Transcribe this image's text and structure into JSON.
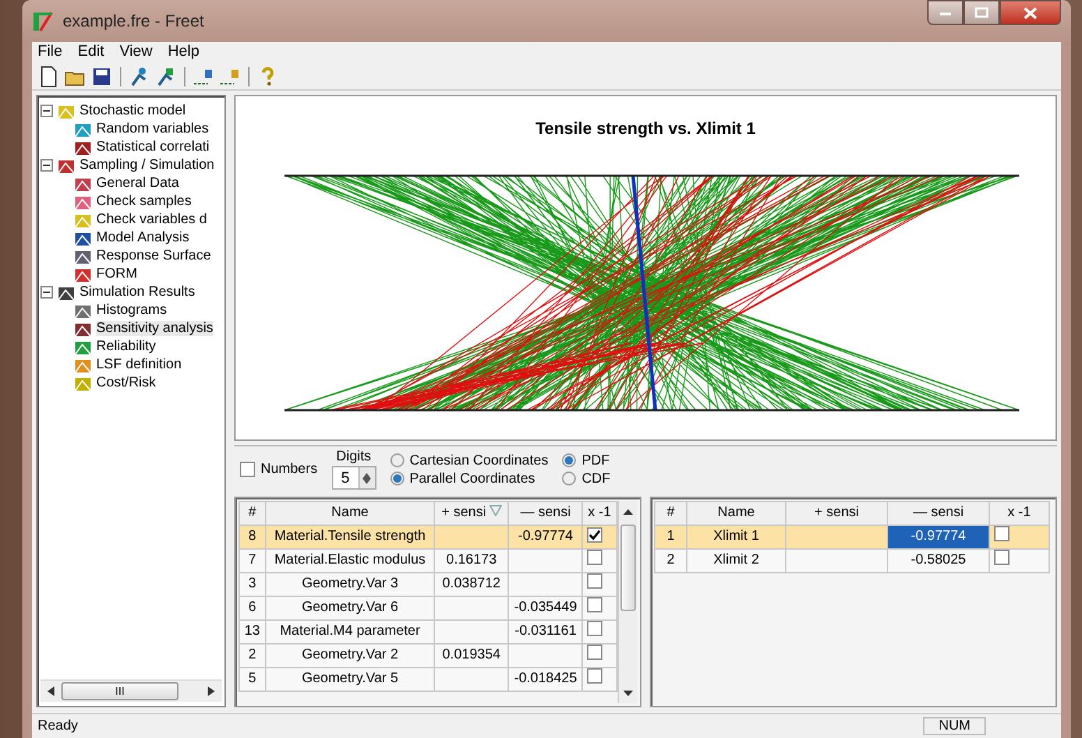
{
  "window": {
    "title": "example.fre - Freet"
  },
  "menu": [
    "File",
    "Edit",
    "View",
    "Help"
  ],
  "tree": [
    {
      "label": "Stochastic model",
      "expanded": true,
      "children": [
        {
          "label": "Random variables",
          "selected": false
        },
        {
          "label": "Statistical correlati",
          "selected": false
        }
      ]
    },
    {
      "label": "Sampling / Simulation",
      "expanded": true,
      "children": [
        {
          "label": "General Data",
          "selected": false
        },
        {
          "label": "Check samples",
          "selected": false
        },
        {
          "label": "Check variables d",
          "selected": false
        },
        {
          "label": "Model Analysis",
          "selected": false
        },
        {
          "label": "Response Surface",
          "selected": false
        },
        {
          "label": "FORM",
          "selected": false
        }
      ]
    },
    {
      "label": "Simulation Results",
      "expanded": true,
      "children": [
        {
          "label": "Histograms",
          "selected": false
        },
        {
          "label": "Sensitivity analysis",
          "selected": true
        },
        {
          "label": "Reliability",
          "selected": false
        },
        {
          "label": "LSF definition",
          "selected": false
        },
        {
          "label": "Cost/Risk",
          "selected": false
        }
      ]
    }
  ],
  "tree_scrollbar": {
    "grip": "III"
  },
  "chart": {
    "title": "Tensile strength vs. Xlimit 1"
  },
  "options": {
    "numbers": {
      "label": "Numbers",
      "checked": false
    },
    "digits": {
      "label": "Digits",
      "value": "5"
    },
    "coordinates": [
      {
        "label": "Cartesian Coordinates",
        "selected": false
      },
      {
        "label": "Parallel Coordinates",
        "selected": true
      }
    ],
    "distribution": [
      {
        "label": "PDF",
        "selected": true
      },
      {
        "label": "CDF",
        "selected": false
      }
    ]
  },
  "left_table": {
    "columns": [
      {
        "label": "#",
        "sorted": false
      },
      {
        "label": "Name",
        "sorted": false
      },
      {
        "label": "+ sensi",
        "sorted": true
      },
      {
        "label": "— sensi",
        "sorted": false
      },
      {
        "label": "x -1",
        "sorted": false
      }
    ],
    "rows": [
      {
        "index": "8",
        "name": "Material.Tensile strength",
        "plus": "",
        "minus": "-0.97774",
        "checked": true,
        "selected": true,
        "minus_selected": false
      },
      {
        "index": "7",
        "name": "Material.Elastic modulus",
        "plus": "0.16173",
        "minus": "",
        "checked": false,
        "selected": false,
        "minus_selected": false
      },
      {
        "index": "3",
        "name": "Geometry.Var 3",
        "plus": "0.038712",
        "minus": "",
        "checked": false,
        "selected": false,
        "minus_selected": false
      },
      {
        "index": "6",
        "name": "Geometry.Var 6",
        "plus": "",
        "minus": "-0.035449",
        "checked": false,
        "selected": false,
        "minus_selected": false
      },
      {
        "index": "13",
        "name": "Material.M4 parameter",
        "plus": "",
        "minus": "-0.031161",
        "checked": false,
        "selected": false,
        "minus_selected": false
      },
      {
        "index": "2",
        "name": "Geometry.Var 2",
        "plus": "0.019354",
        "minus": "",
        "checked": false,
        "selected": false,
        "minus_selected": false
      },
      {
        "index": "5",
        "name": "Geometry.Var 5",
        "plus": "",
        "minus": "-0.018425",
        "checked": false,
        "selected": false,
        "minus_selected": false
      }
    ]
  },
  "right_table": {
    "columns": [
      {
        "label": "#",
        "sorted": false
      },
      {
        "label": "Name",
        "sorted": false
      },
      {
        "label": "+ sensi",
        "sorted": false
      },
      {
        "label": "— sensi",
        "sorted": false
      },
      {
        "label": "x -1",
        "sorted": false
      }
    ],
    "rows": [
      {
        "index": "1",
        "name": "Xlimit 1",
        "plus": "",
        "minus": "-0.97774",
        "checked": false,
        "selected": true,
        "minus_selected": true
      },
      {
        "index": "2",
        "name": "Xlimit 2",
        "plus": "",
        "minus": "-0.58025",
        "checked": false,
        "selected": false,
        "minus_selected": false
      }
    ]
  },
  "status_bar": {
    "text": "Ready",
    "num": "NUM"
  }
}
